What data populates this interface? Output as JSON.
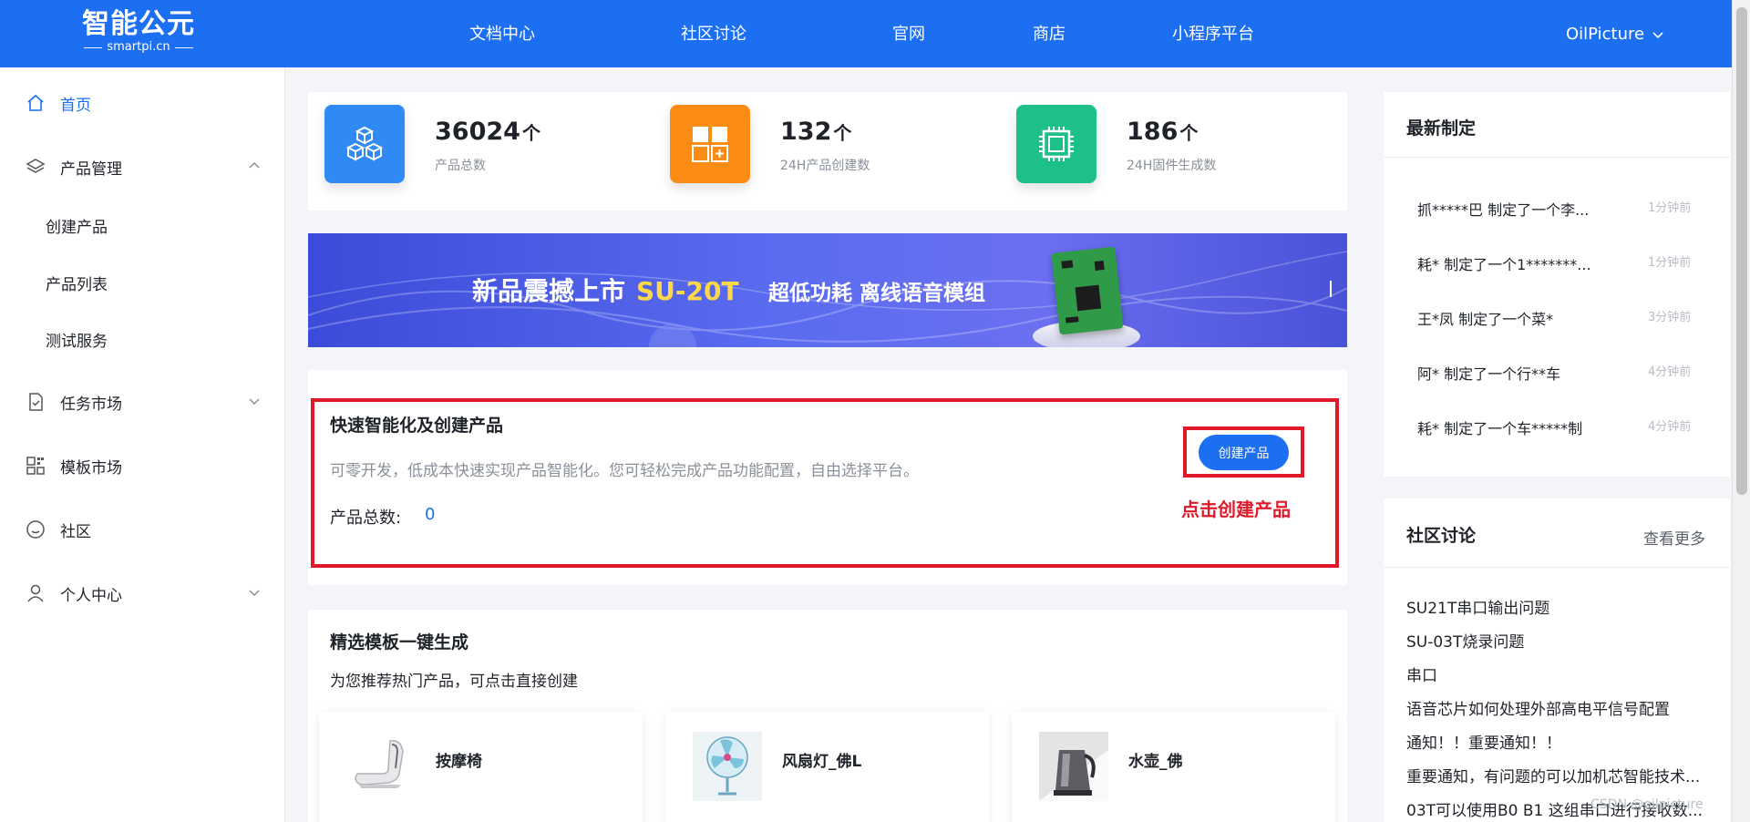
{
  "header": {
    "logo": {
      "main": "智能公元",
      "sub": "smartpi.cn"
    },
    "nav": [
      "文档中心",
      "社区讨论",
      "官网",
      "商店",
      "小程序平台"
    ],
    "user": "OilPicture"
  },
  "sidebar": {
    "items": [
      {
        "label": "首页",
        "icon": "home-icon"
      },
      {
        "label": "产品管理",
        "icon": "layers-icon"
      },
      {
        "label": "创建产品"
      },
      {
        "label": "产品列表"
      },
      {
        "label": "测试服务"
      },
      {
        "label": "任务市场",
        "icon": "task-icon"
      },
      {
        "label": "模板市场",
        "icon": "grid-icon"
      },
      {
        "label": "社区",
        "icon": "smile-icon"
      },
      {
        "label": "个人中心",
        "icon": "user-icon"
      }
    ]
  },
  "stats": [
    {
      "value": "36024",
      "unit": "个",
      "label": "产品总数",
      "color": "#2f8af5",
      "icon": "cubes-icon"
    },
    {
      "value": "132",
      "unit": "个",
      "label": "24H产品创建数",
      "color": "#fa8c16",
      "icon": "add-grid-icon"
    },
    {
      "value": "186",
      "unit": "个",
      "label": "24H固件生成数",
      "color": "#1dbf8a",
      "icon": "chip-icon"
    }
  ],
  "banner": {
    "headline": "新品震撼上市",
    "model": "SU-20T",
    "features": "超低功耗  离线语音模组"
  },
  "quick_create": {
    "title": "快速智能化及创建产品",
    "description": "可零开发，低成本快速实现产品智能化。您可轻松完成产品功能配置，自由选择平台。",
    "count_label": "产品总数:",
    "count_value": "0",
    "button_label": "创建产品",
    "hint": "点击创建产品"
  },
  "templates": {
    "title": "精选模板一键生成",
    "subtitle": "为您推荐热门产品，可点击直接创建",
    "items": [
      {
        "name": "按摩椅"
      },
      {
        "name": "风扇灯_佛L"
      },
      {
        "name": "水壶_佛"
      }
    ]
  },
  "latest": {
    "title": "最新制定",
    "items": [
      {
        "text": "抓*****巴 制定了一个李...",
        "time": "1分钟前"
      },
      {
        "text": "耗* 制定了一个1*******...",
        "time": "1分钟前"
      },
      {
        "text": "王*凤 制定了一个菜*",
        "time": "3分钟前"
      },
      {
        "text": "阿* 制定了一个行**车",
        "time": "4分钟前"
      },
      {
        "text": "耗* 制定了一个车*****制",
        "time": "4分钟前"
      }
    ]
  },
  "community": {
    "title": "社区讨论",
    "more": "查看更多",
    "items": [
      "SU21T串口输出问题",
      "SU-03T烧录问题",
      "串口",
      "语音芯片如何处理外部高电平信号配置",
      "通知！！重要通知！！",
      "重要通知，有问题的可以加机芯智能技术...",
      "03T可以使用B0 B1 这组串口进行接收数..."
    ]
  },
  "watermark": "CSDN @oilpicture"
}
